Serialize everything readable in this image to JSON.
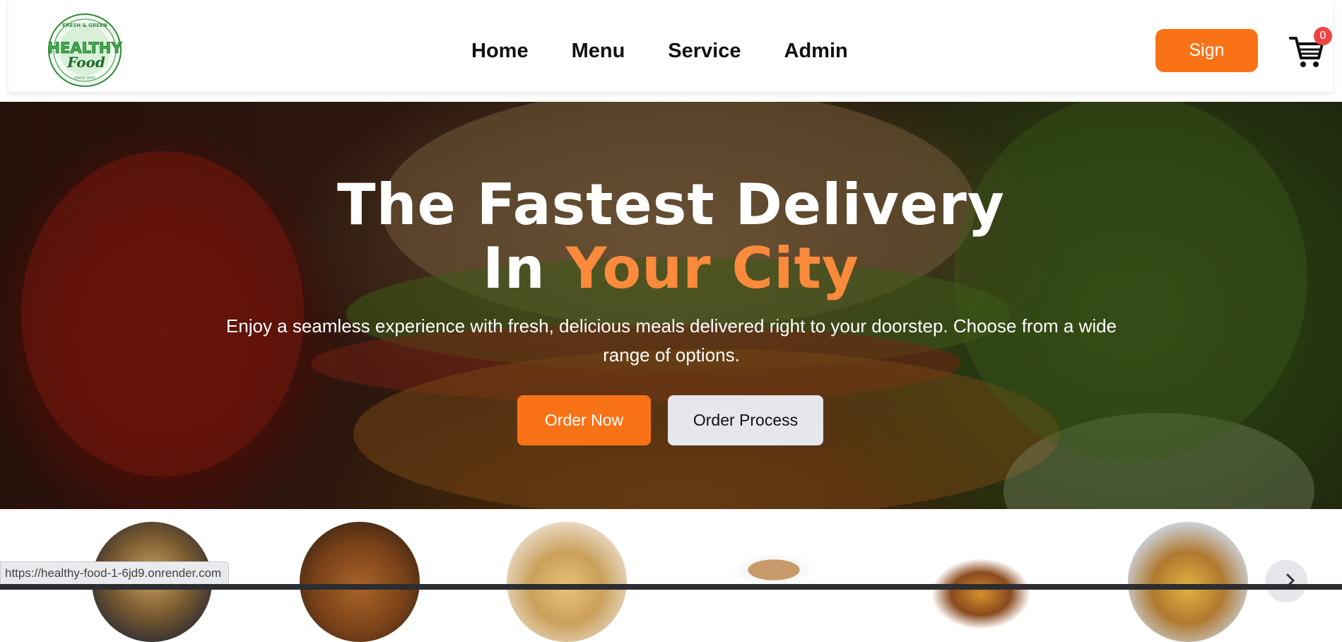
{
  "header": {
    "logo": {
      "top_text": "FRESH & GREEN",
      "main_text": "HEALTHY",
      "script_text": "Food",
      "bottom_text": "SINCE 2000"
    },
    "nav": [
      {
        "label": "Home"
      },
      {
        "label": "Menu"
      },
      {
        "label": "Service"
      },
      {
        "label": "Admin"
      }
    ],
    "sign_label": "Sign",
    "cart_count": "0"
  },
  "hero": {
    "title_line1": "The Fastest Delivery",
    "title_line2_prefix": "In ",
    "title_line2_accent": "Your City",
    "subtitle": "Enjoy a seamless experience with fresh, delicious meals delivered right to your doorstep. Choose from a wide range of options.",
    "primary_button": "Order Now",
    "secondary_button": "Order Process"
  },
  "carousel": {
    "items": [
      {
        "icon": "noodles-bowl-image"
      },
      {
        "icon": "grilled-chicken-image"
      },
      {
        "icon": "dosa-plate-image"
      },
      {
        "icon": "tea-cup-image"
      },
      {
        "icon": "burger-image"
      },
      {
        "icon": "thali-image"
      }
    ]
  },
  "status_bar": {
    "url": "https://healthy-food-1-6jd9.onrender.com"
  },
  "colors": {
    "accent": "#f97316",
    "accent_text": "#fb8a3c",
    "badge": "#ef4444"
  }
}
